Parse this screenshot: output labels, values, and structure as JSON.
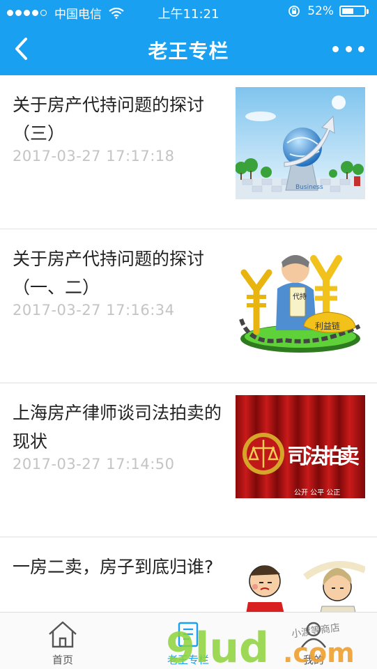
{
  "status_bar": {
    "carrier": "中国电信",
    "time": "上午11:21",
    "battery_text": "52%",
    "battery_level": 0.52
  },
  "nav": {
    "title": "老王专栏"
  },
  "articles": [
    {
      "title": "关于房产代持问题的探讨（三）",
      "time": "2017-03-27 17:17:18"
    },
    {
      "title": "关于房产代持问题的探讨（一、二）",
      "time": "2017-03-27 17:16:34"
    },
    {
      "title": "上海房产律师谈司法拍卖的现状",
      "time": "2017-03-27 17:14:50"
    },
    {
      "title": "一房二卖，房子到底归谁?",
      "time": ""
    }
  ],
  "thumb_texts": {
    "business": "Business",
    "daichi": "代持",
    "liyilian": "利益链",
    "sifa": "司法拍卖",
    "gongkai": "公开 公平 公正"
  },
  "tabs": [
    {
      "label": "首页",
      "icon": "home-icon"
    },
    {
      "label": "老王专栏",
      "icon": "column-icon"
    },
    {
      "label": "我的",
      "icon": "user-icon"
    }
  ],
  "watermark": {
    "brand": "9lud",
    "suffix": ".com",
    "tagline": "小渡等商店"
  },
  "colors": {
    "accent": "#1aa0f0",
    "time_text": "#c4c4c4"
  }
}
